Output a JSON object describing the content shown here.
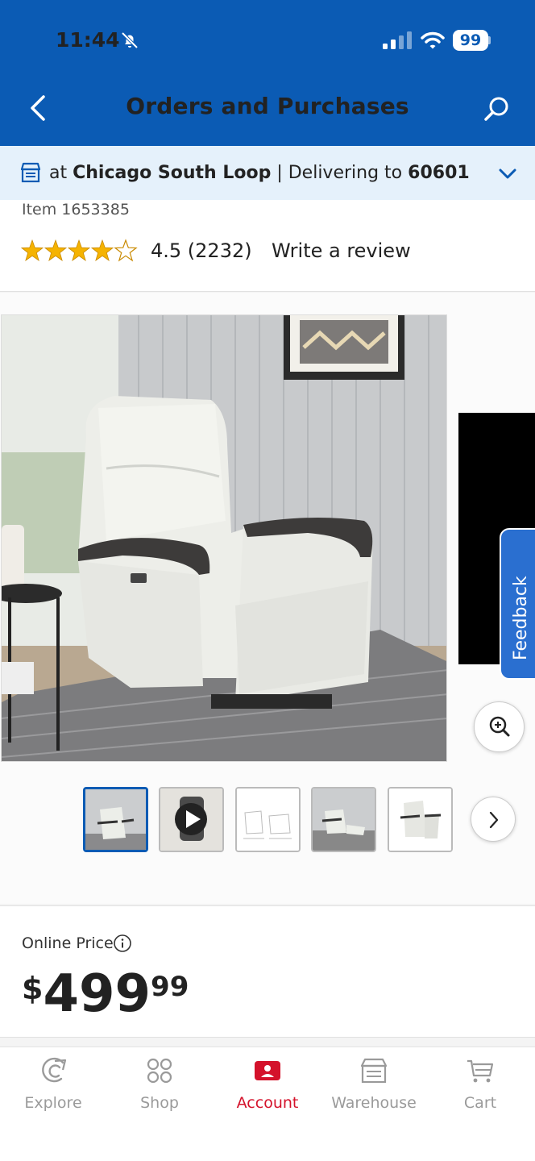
{
  "status_bar": {
    "time": "11:44",
    "battery": "99"
  },
  "header": {
    "title": "Orders and Purchases"
  },
  "location": {
    "at": "at",
    "store": "Chicago South Loop",
    "separator": " | ",
    "delivering": "Delivering to",
    "zip": "60601"
  },
  "product": {
    "item_number": "Item 1653385",
    "rating_stars": 4.5,
    "rating": "4.5 (2232)",
    "write_review": "Write a review"
  },
  "gallery": {
    "feedback": "Feedback",
    "thumbnail_count": 5,
    "selected_thumbnail": 1,
    "video_thumbnail": 2
  },
  "price": {
    "label": "Online Price",
    "currency": "$",
    "dollars": "499",
    "cents": "99"
  },
  "tabs": [
    {
      "label": "Explore",
      "icon": "explore-icon",
      "active": false
    },
    {
      "label": "Shop",
      "icon": "grid-icon",
      "active": false
    },
    {
      "label": "Account",
      "icon": "account-icon",
      "active": true
    },
    {
      "label": "Warehouse",
      "icon": "warehouse-icon",
      "active": false
    },
    {
      "label": "Cart",
      "icon": "cart-icon",
      "active": false
    }
  ],
  "colors": {
    "brand_blue": "#0b5bb4",
    "active_red": "#d4122b",
    "star_gold": "#f5b301"
  }
}
